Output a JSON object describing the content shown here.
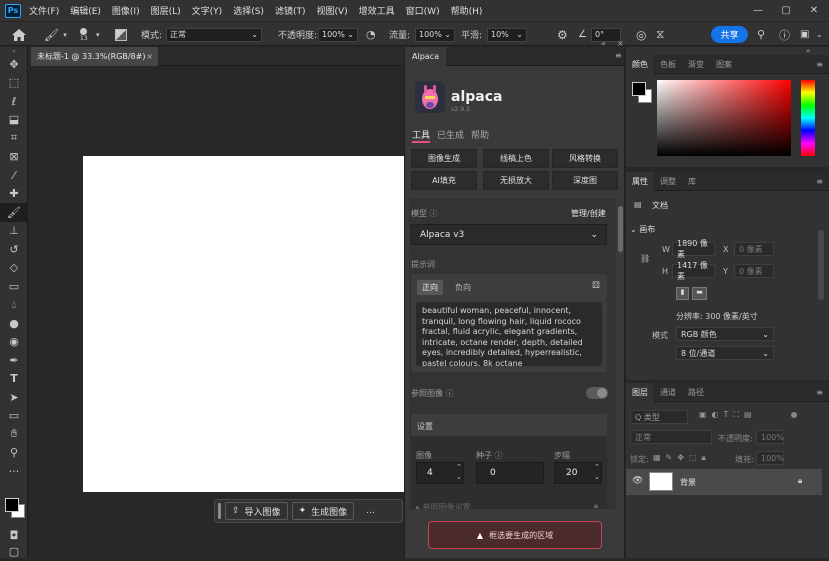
{
  "menubar": {
    "app_icon": "Ps",
    "items": [
      "文件(F)",
      "编辑(E)",
      "图像(I)",
      "图层(L)",
      "文字(Y)",
      "选择(S)",
      "滤镜(T)",
      "视图(V)",
      "增效工具",
      "窗口(W)",
      "帮助(H)"
    ],
    "window_controls": [
      "minimize-icon",
      "maximize-icon",
      "close-icon"
    ]
  },
  "options": {
    "brush_size": "13",
    "mode_label": "模式:",
    "mode_value": "正常",
    "opacity_label": "不透明度:",
    "opacity_value": "100%",
    "flow_label": "流量:",
    "flow_value": "100%",
    "smooth_label": "平滑:",
    "smooth_value": "10%",
    "angle_value": "0°",
    "share_label": "共享"
  },
  "document": {
    "tab_title": "未标题-1 @ 33.3%(RGB/8#)",
    "tab_close": "×"
  },
  "floatbar": {
    "import_label": "导入图像",
    "generate_label": "生成图像",
    "more": "..."
  },
  "alpaca": {
    "panel_tab": "Alpaca",
    "name": "alpaca",
    "version": "v2.9.3",
    "tabs": [
      "工具",
      "已生成",
      "帮助"
    ],
    "tools": [
      "图像生成",
      "线稿上色",
      "风格转换",
      "AI填充",
      "无损放大",
      "深度图"
    ],
    "model_label": "模型",
    "manage_label": "管理/创建",
    "model_value": "Alpaca v3",
    "prompt_label": "提示词",
    "prompt_tabs": [
      "正向",
      "负向"
    ],
    "prompt_text": "beautiful woman, peaceful, innocent, tranquil, long flowing hair, liquid rococo fractal, fluid acrylic, elegant gradients, intricate, octane render, depth, detailed eyes, incredibly detailed, hyperrealistic, pastel colours, 8k octane",
    "ref_label": "参照图像",
    "settings_label": "设置",
    "image_label": "图像",
    "seed_label": "种子",
    "steps_label": "步幅",
    "image_value": "4",
    "seed_value": "0",
    "steps_value": "20",
    "more_settings": "▸ 参照图像设置",
    "warning": "框选要生成的区域"
  },
  "color_panel": {
    "tabs": [
      "颜色",
      "色板",
      "渐变",
      "图案"
    ],
    "foreground": "#000000",
    "background": "#ffffff",
    "hue_color": "#ff0000"
  },
  "properties": {
    "tabs": [
      "属性",
      "调整",
      "库"
    ],
    "doc_label": "文档",
    "section": "画布",
    "w_label": "W",
    "w_value": "1890 像素",
    "x_label": "X",
    "x_value": "0 像素",
    "h_label": "H",
    "h_value": "1417 像素",
    "y_label": "Y",
    "y_value": "0 像素",
    "resolution": "分辨率: 300 像素/英寸",
    "mode_label": "模式",
    "mode_value": "RGB 颜色",
    "depth_value": "8 位/通道"
  },
  "layers": {
    "tabs": [
      "图层",
      "通道",
      "路径"
    ],
    "filter_label": "Q 类型",
    "blend": "正常",
    "opacity_label": "不透明度:",
    "opacity_value": "100%",
    "lock_label": "锁定:",
    "fill_label": "填充:",
    "fill_value": "100%",
    "layer_name": "背景"
  }
}
